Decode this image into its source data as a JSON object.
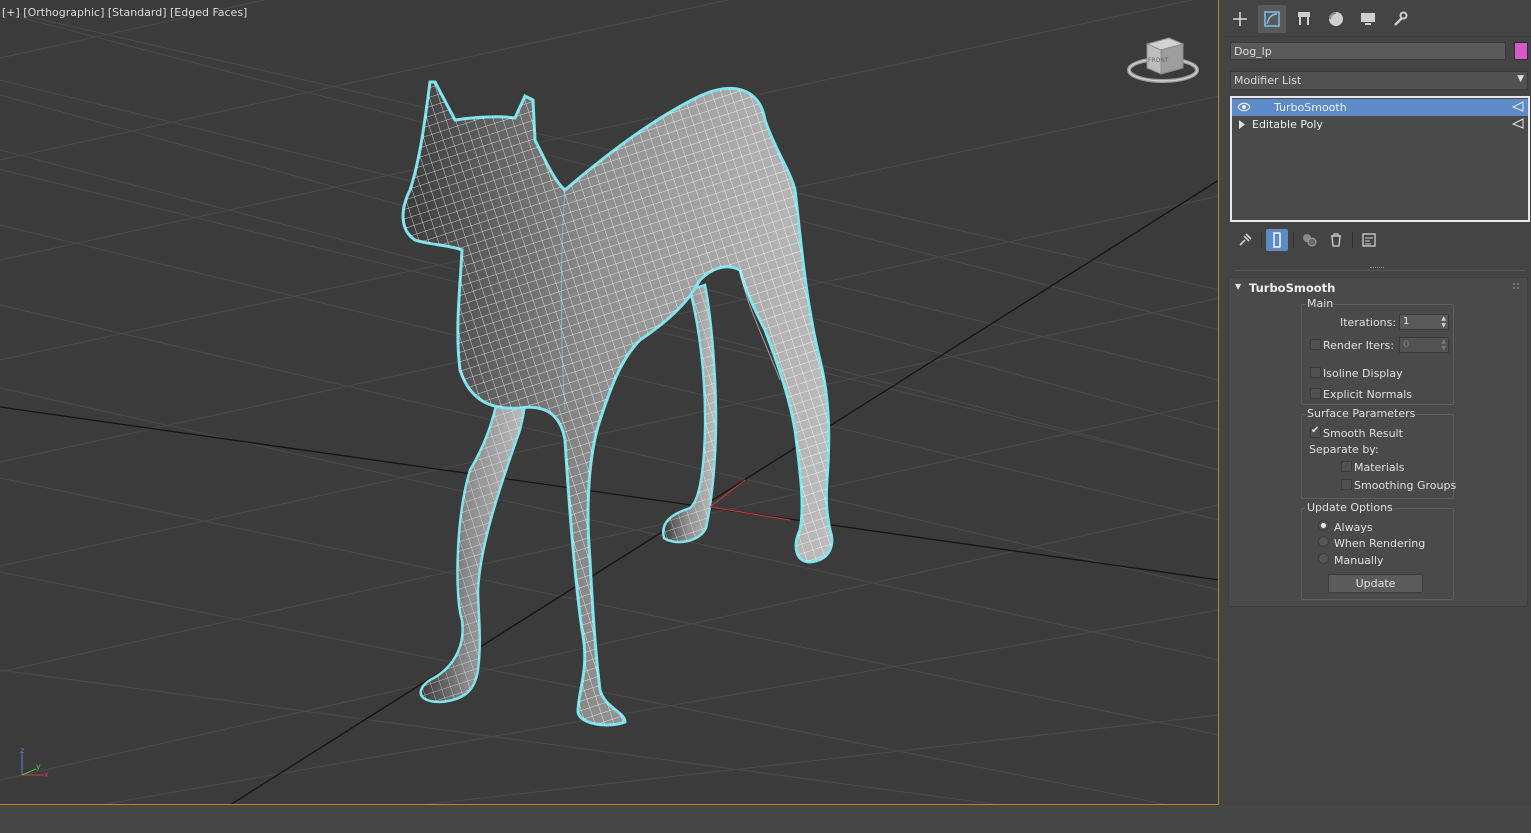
{
  "viewport": {
    "label": "[+] [Orthographic] [Standard] [Edged Faces]",
    "viewcube_face": "FRONT",
    "axis_labels": {
      "x": "x",
      "y": "y",
      "z": "z"
    }
  },
  "command_panel": {
    "tabs": [
      {
        "name": "create-icon"
      },
      {
        "name": "modify-icon",
        "active": true
      },
      {
        "name": "hierarchy-icon"
      },
      {
        "name": "motion-icon"
      },
      {
        "name": "display-icon"
      },
      {
        "name": "utilities-icon"
      }
    ],
    "object_name": "Dog_lp",
    "object_color": "#d658c9",
    "modifier_list": "Modifier List",
    "stack": [
      {
        "label": "TurboSmooth",
        "selected": true
      },
      {
        "label": "Editable Poly",
        "selected": false
      }
    ],
    "rollout": {
      "title": "TurboSmooth",
      "main": {
        "title": "Main",
        "iterations_label": "Iterations:",
        "iterations_value": "1",
        "render_iters_label": "Render Iters:",
        "render_iters_value": "0",
        "render_iters_checked": false,
        "isoline_label": "Isoline Display",
        "isoline_checked": false,
        "explicit_normals_label": "Explicit Normals",
        "explicit_normals_checked": false
      },
      "surface": {
        "title": "Surface Parameters",
        "smooth_result_label": "Smooth Result",
        "smooth_result_checked": true,
        "separate_by_label": "Separate by:",
        "materials_label": "Materials",
        "materials_checked": false,
        "smoothing_groups_label": "Smoothing Groups",
        "smoothing_groups_checked": false
      },
      "update": {
        "title": "Update Options",
        "always_label": "Always",
        "when_rendering_label": "When Rendering",
        "manually_label": "Manually",
        "selected": "Always",
        "update_button": "Update"
      }
    }
  },
  "colors": {
    "viewport_bg": "#3b3b3b",
    "panel_bg": "#444444",
    "selection": "#5d8ac8",
    "viewport_border": "#b08a2a",
    "wireframe_highlight": "#7fe3ee"
  }
}
